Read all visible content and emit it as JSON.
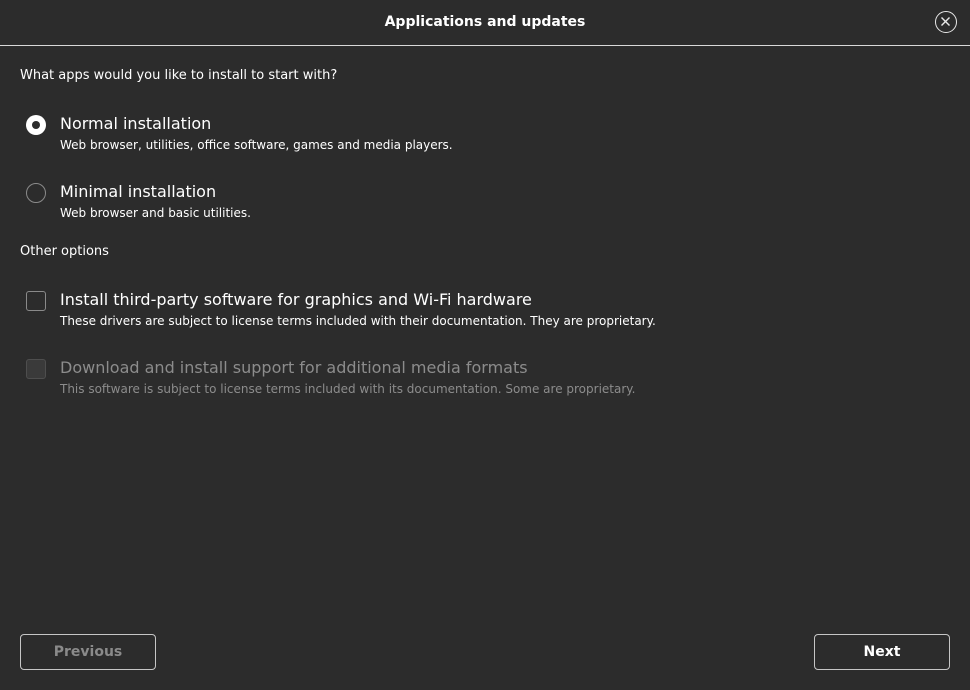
{
  "window": {
    "title": "Applications and updates",
    "close_icon": "close-icon"
  },
  "install_type": {
    "question": "What apps would you like to install to start with?",
    "selected": "normal",
    "options": [
      {
        "id": "normal",
        "label": "Normal installation",
        "description": "Web browser, utilities, office software, games and media players.",
        "checked": true
      },
      {
        "id": "minimal",
        "label": "Minimal installation",
        "description": "Web browser and basic utilities.",
        "checked": false
      }
    ]
  },
  "other_options": {
    "heading": "Other options",
    "items": [
      {
        "label": "Install third-party software for graphics and Wi-Fi hardware",
        "description": "These drivers are subject to license terms included with their documentation. They are proprietary.",
        "checked": false,
        "enabled": true
      },
      {
        "label": "Download and install support for additional media formats",
        "description": "This software is subject to license terms included with its documentation. Some are proprietary.",
        "checked": false,
        "enabled": false
      }
    ]
  },
  "footer": {
    "previous_label": "Previous",
    "next_label": "Next"
  },
  "colors": {
    "background": "#2c2c2c",
    "text": "#ffffff",
    "disabled_text": "#8c8c8c",
    "border": "#c6c6c6"
  }
}
